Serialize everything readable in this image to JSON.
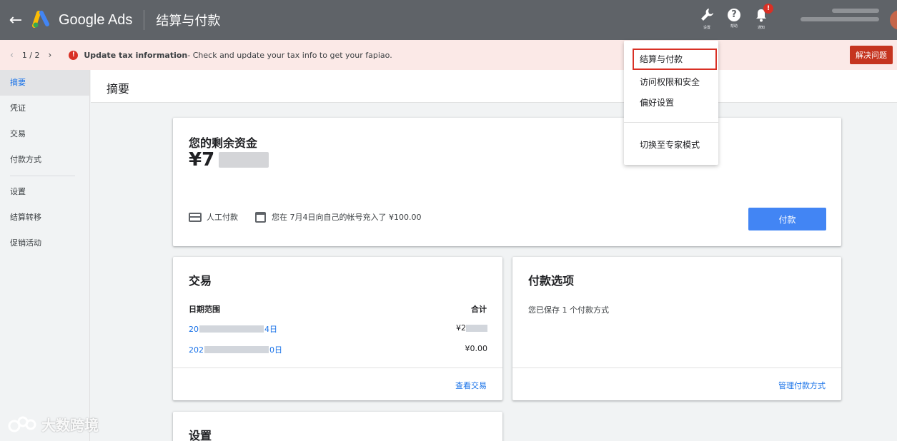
{
  "topbar": {
    "brand": "Google Ads",
    "page_title": "结算与付款",
    "icons": [
      {
        "name": "wrench-icon",
        "label": "设置"
      },
      {
        "name": "help-icon",
        "label": "帮助"
      },
      {
        "name": "bell-icon",
        "label": "通知",
        "badge": "!"
      }
    ]
  },
  "notice": {
    "pager": "1 / 2",
    "title": "Update tax information",
    "text": " - Check and update your tax info to get your fapiao.",
    "button": "解决问题"
  },
  "sidebar": {
    "items": [
      "摘要",
      "凭证",
      "交易",
      "付款方式",
      "设置",
      "结算转移",
      "促销活动"
    ]
  },
  "main": {
    "title": "摘要"
  },
  "funds": {
    "title": "您的剩余资金",
    "amount": "¥7",
    "method": "人工付款",
    "last_payment": "您在 7月4日向自己的帐号充入了 ¥100.00",
    "pay_button": "付款"
  },
  "transactions": {
    "title": "交易",
    "col_date": "日期范围",
    "col_total": "合计",
    "rows": [
      {
        "date_start": "20",
        "date_end": "4日",
        "amount": "¥2"
      },
      {
        "date_start": "202",
        "date_end": "0日",
        "amount": "¥0.00"
      }
    ],
    "link": "查看交易"
  },
  "payment_options": {
    "title": "付款选项",
    "saved": "您已保存 1 个付款方式",
    "link": "管理付款方式"
  },
  "settings": {
    "title": "设置"
  },
  "menu": {
    "items": [
      "结算与付款",
      "访问权限和安全",
      "偏好设置",
      "切换至专家模式"
    ]
  },
  "watermark": {
    "text": "大数跨境"
  },
  "colors": {
    "topbar": "#5f6368",
    "notice_bg": "#fbe9e7",
    "error": "#d93025",
    "accent": "#4285f4",
    "link": "#1a73e8"
  }
}
